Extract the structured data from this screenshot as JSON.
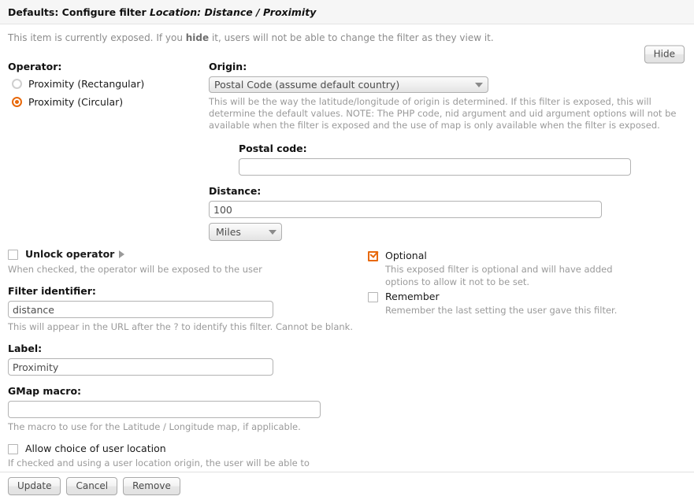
{
  "header": {
    "title_prefix": "Defaults: Configure filter ",
    "title_emphasis": "Location: Distance / Proximity"
  },
  "intro": {
    "text_before": "This item is currently exposed. If you ",
    "bold_word": "hide",
    "text_after": " it, users will not be able to change the filter as they view it.",
    "hide_button": "Hide"
  },
  "operator": {
    "label": "Operator:",
    "options": [
      {
        "label": "Proximity (Rectangular)",
        "selected": false
      },
      {
        "label": "Proximity (Circular)",
        "selected": true
      }
    ]
  },
  "origin": {
    "label": "Origin:",
    "selected": "Postal Code (assume default country)",
    "description": "This will be the way the latitude/longitude of origin is determined. If this filter is exposed, this will determine the default values. NOTE: The PHP code, nid argument and uid argument options will not be available when the filter is exposed and the use of map is only available when the filter is exposed."
  },
  "postal_code": {
    "label": "Postal code:",
    "value": "",
    "placeholder": ""
  },
  "distance": {
    "label": "Distance:",
    "value": "100",
    "units_selected": "Miles"
  },
  "unlock_operator": {
    "label": "Unlock operator",
    "checked": false,
    "description": "When checked, the operator will be exposed to the user"
  },
  "filter_identifier": {
    "label": "Filter identifier:",
    "value": "distance",
    "description": "This will appear in the URL after the ? to identify this filter. Cannot be blank."
  },
  "filter_label": {
    "label": "Label:",
    "value": "Proximity"
  },
  "gmap_macro": {
    "label": "GMap macro:",
    "value": "",
    "description": "The macro to use for the Latitude / Longitude map, if applicable."
  },
  "allow_choice": {
    "label": "Allow choice of user location",
    "checked": false,
    "description": "If checked and using a user location origin, the user will be able to choose which of their locations to use. Otherwise their first location will be used."
  },
  "exposed_options": [
    {
      "label": "Optional",
      "checked": true,
      "description": "This exposed filter is optional and will have added options to allow it not to be set."
    },
    {
      "label": "Remember",
      "checked": false,
      "description": "Remember the last setting the user gave this filter."
    }
  ],
  "footer": {
    "update": "Update",
    "cancel": "Cancel",
    "remove": "Remove"
  },
  "colors": {
    "accent": "#e8690b",
    "header_bg": "#f6f6f6",
    "muted_text": "#9a9a9a"
  }
}
